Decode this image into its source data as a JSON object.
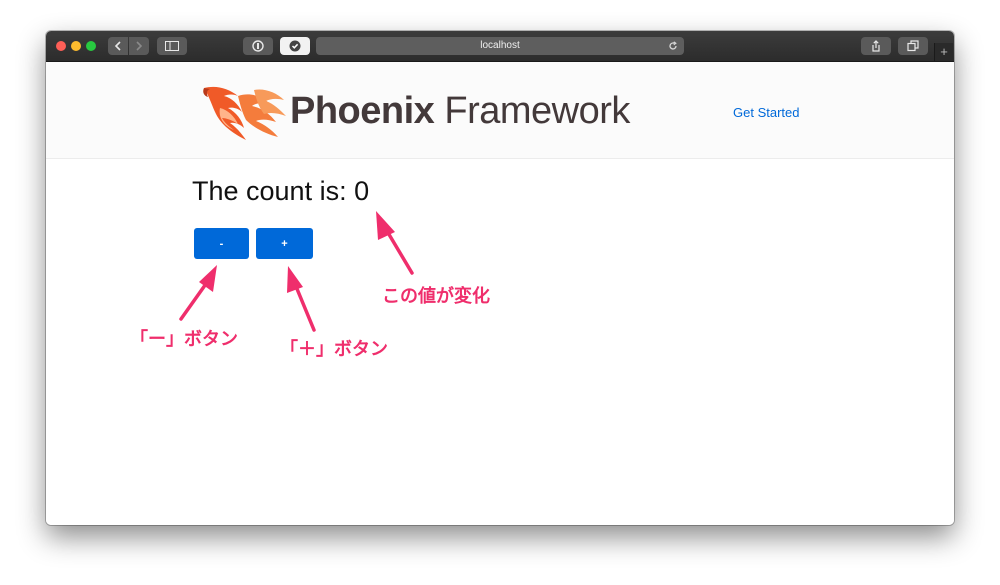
{
  "browser": {
    "address": "localhost",
    "back_icon": "chevron-left-icon",
    "forward_icon": "chevron-right-icon",
    "reload_icon": "reload-icon",
    "newtab_label": "+"
  },
  "header": {
    "logo_bold": "Phoenix",
    "logo_regular": " Framework",
    "get_started": "Get Started"
  },
  "main": {
    "count_label": "The count is: 0",
    "minus_label": "-",
    "plus_label": "+"
  },
  "annotations": {
    "value_changes": "この値が変化",
    "minus_button": "「ー」ボタン",
    "plus_button": "「＋」ボタン"
  },
  "colors": {
    "accent": "#0069d9",
    "annotation": "#ef2e6c",
    "logo_orange": "#f05a28"
  }
}
